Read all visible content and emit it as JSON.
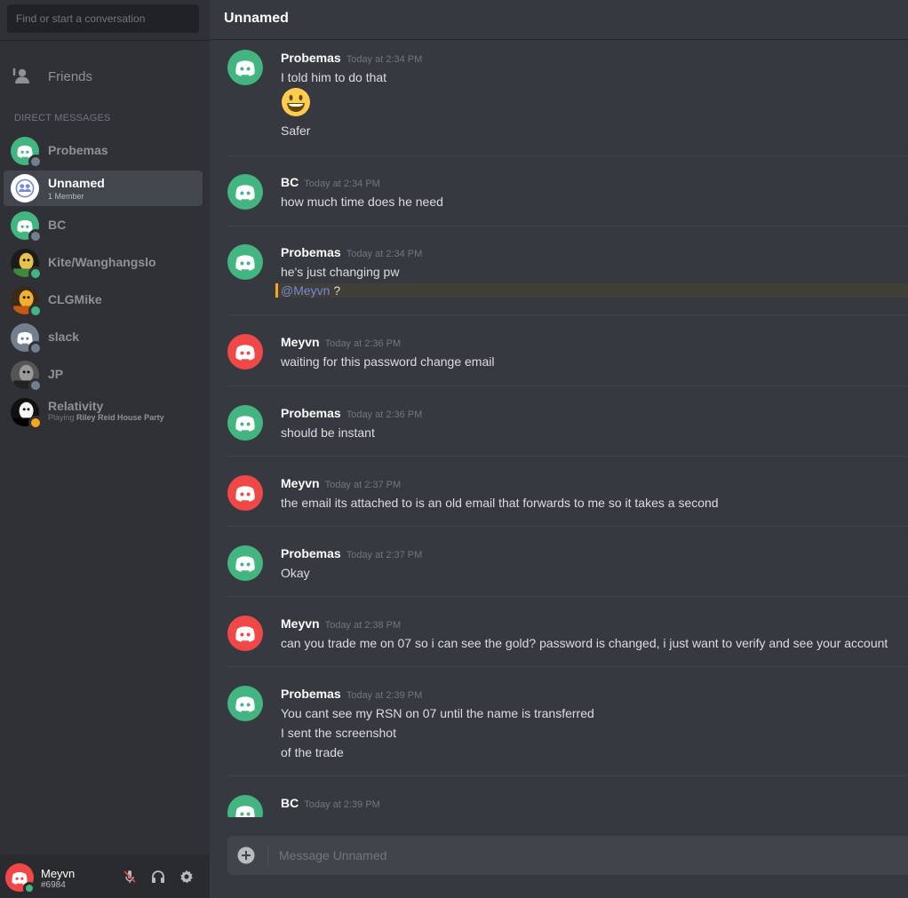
{
  "colors": {
    "green_avatar": "#43b581",
    "red_avatar": "#f04747",
    "blurple": "#7289da",
    "mention_bar": "#faa61a",
    "offline_status": "#747f8d",
    "online_status": "#43b581",
    "idle_status": "#faa61a"
  },
  "sidebar": {
    "search_placeholder": "Find or start a conversation",
    "friends_label": "Friends",
    "friends_icon": "friends-icon",
    "dm_header": "DIRECT MESSAGES",
    "dms": [
      {
        "name": "Probemas",
        "avatar": "discord-green",
        "status": "offline"
      },
      {
        "name": "Unnamed",
        "sub": "1 Member",
        "avatar": "group-icon",
        "active": true
      },
      {
        "name": "BC",
        "avatar": "discord-green",
        "status": "offline"
      },
      {
        "name": "Kite/Wanghangslo",
        "avatar": "photo-avatar",
        "status": "online"
      },
      {
        "name": "CLGMike",
        "avatar": "photo-avatar",
        "status": "online"
      },
      {
        "name": "slack",
        "avatar": "discord-grey",
        "status": "offline"
      },
      {
        "name": "JP",
        "avatar": "photo-avatar",
        "status": "offline"
      },
      {
        "name": "Relativity",
        "sub_prefix": "Playing",
        "sub_game": "Riley Reid House Party",
        "avatar": "photo-avatar",
        "status": "idle"
      }
    ]
  },
  "user_panel": {
    "name": "Meyvn",
    "tag": "#6984",
    "buttons": [
      "mute-mic-icon",
      "headphones-icon",
      "settings-gear-icon"
    ]
  },
  "channel": {
    "title": "Unnamed",
    "composer_placeholder": "Message Unnamed"
  },
  "messages": [
    {
      "author": "Probemas",
      "time": "Today at 2:34 PM",
      "avatar": "green",
      "lines": [
        "I told him to do that",
        "Safer"
      ],
      "emoji": "smiley-emoji"
    },
    {
      "author": "BC",
      "time": "Today at 2:34 PM",
      "avatar": "green",
      "lines": [
        "how much time does he need"
      ]
    },
    {
      "author": "Probemas",
      "time": "Today at 2:34 PM",
      "avatar": "green",
      "lines": [
        "he's just changing pw"
      ],
      "mention": "@Meyvn",
      "mention_suffix": " ?"
    },
    {
      "author": "Meyvn",
      "time": "Today at 2:36 PM",
      "avatar": "red",
      "lines": [
        "waiting for this password change email"
      ]
    },
    {
      "author": "Probemas",
      "time": "Today at 2:36 PM",
      "avatar": "green",
      "lines": [
        "should be instant"
      ]
    },
    {
      "author": "Meyvn",
      "time": "Today at 2:37 PM",
      "avatar": "red",
      "lines": [
        "the email its attached to is an old email that forwards to me so it takes a second"
      ]
    },
    {
      "author": "Probemas",
      "time": "Today at 2:37 PM",
      "avatar": "green",
      "lines": [
        "Okay"
      ]
    },
    {
      "author": "Meyvn",
      "time": "Today at 2:38 PM",
      "avatar": "red",
      "lines": [
        "can you trade me on 07 so i can see the gold? password is changed, i just want to verify and see your account"
      ]
    },
    {
      "author": "Probemas",
      "time": "Today at 2:39 PM",
      "avatar": "green",
      "lines": [
        "You cant see my RSN on 07 until the name is transferred",
        "I sent the screenshot",
        "of the trade"
      ]
    },
    {
      "author": "BC",
      "time": "Today at 2:39 PM",
      "avatar": "green",
      "lines": []
    }
  ]
}
